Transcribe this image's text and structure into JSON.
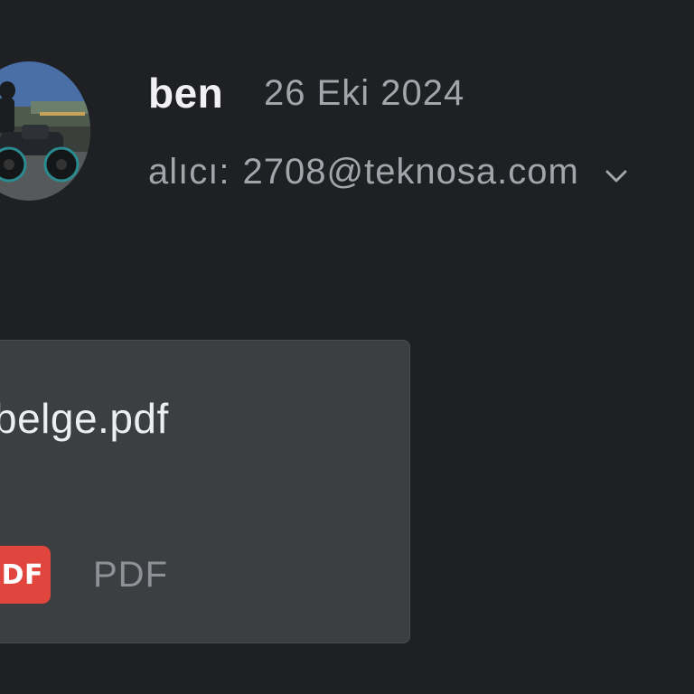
{
  "message": {
    "sender": "ben",
    "date": "26 Eki 2024",
    "recipient_label": "alıcı:",
    "recipient_email": "2708@teknosa.com",
    "expand_icon": "chevron-down-icon",
    "avatar_icon": "profile-photo"
  },
  "attachment": {
    "file_name": "belge.pdf",
    "badge_text": "PDF",
    "file_type": "PDF",
    "badge_color": "#e0463e"
  },
  "colors": {
    "background": "#1f2023",
    "card": "#3c3e42",
    "primary_text": "#f1f1f3",
    "secondary_text": "#a3a5ab"
  }
}
